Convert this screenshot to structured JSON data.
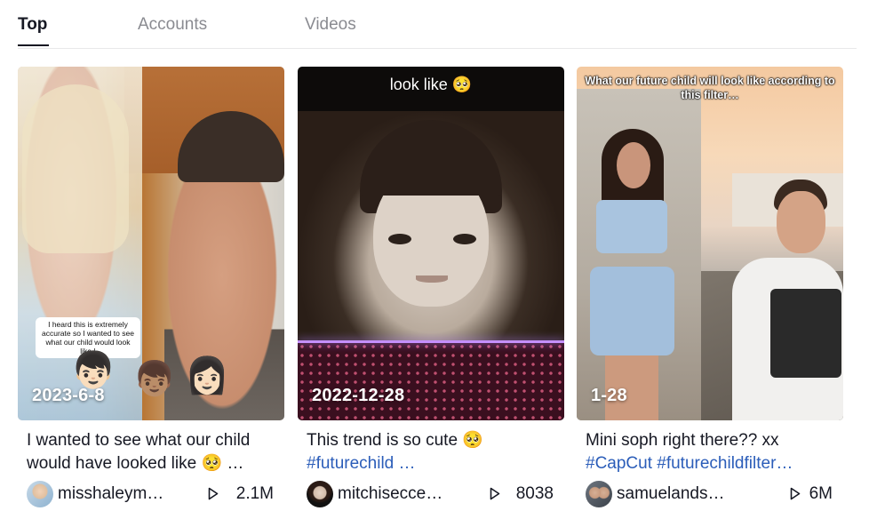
{
  "tabs": [
    {
      "label": "Top",
      "active": true
    },
    {
      "label": "Accounts",
      "active": false
    },
    {
      "label": "Videos",
      "active": false
    }
  ],
  "videos": [
    {
      "date": "2023-6-8",
      "caption_text": "I wanted to see what our child would have looked like 🥺 …",
      "username": "misshaleym…",
      "views": "2.1M",
      "overlay_text": "I heard this is extremely accurate so I wanted to see what our child would look like !",
      "overlay_emojis": [
        "👦🏻",
        "👦🏽",
        "👩🏻"
      ]
    },
    {
      "date": "2022-12-28",
      "caption_text": "This trend is so cute 🥺",
      "caption_tag": "#futurechild …",
      "username": "mitchisecce…",
      "views": "8038",
      "overlay_text": "look like 🥺"
    },
    {
      "date": "1-28",
      "caption_text": "Mini soph right there?? xx",
      "caption_tag": "#CapCut #futurechildfilter…",
      "username": "samuelands…",
      "views": "6M",
      "overlay_text": "What our future child will look like according to this filter…"
    }
  ],
  "colors": {
    "text": "#161823",
    "muted_tab": "#8a8b91",
    "hashtag": "#2b5db9",
    "divider": "#e8e8ea"
  },
  "icons": {
    "views": "play-outline-icon"
  }
}
